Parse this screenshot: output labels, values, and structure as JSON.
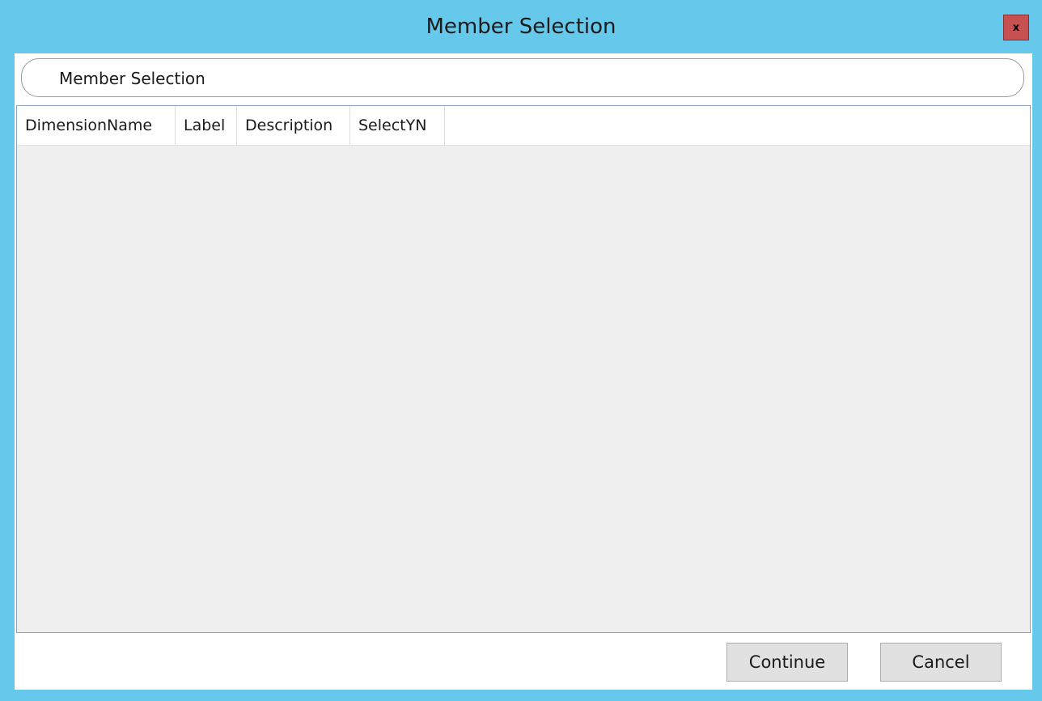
{
  "window": {
    "title": "Member Selection",
    "close_label": "x",
    "accent_color": "#66c9eb",
    "close_color": "#c75050"
  },
  "group": {
    "header": "Member Selection"
  },
  "grid": {
    "columns": [
      "DimensionName",
      "Label",
      "Description",
      "SelectYN"
    ],
    "rows": []
  },
  "footer": {
    "continue_label": "Continue",
    "cancel_label": "Cancel"
  }
}
